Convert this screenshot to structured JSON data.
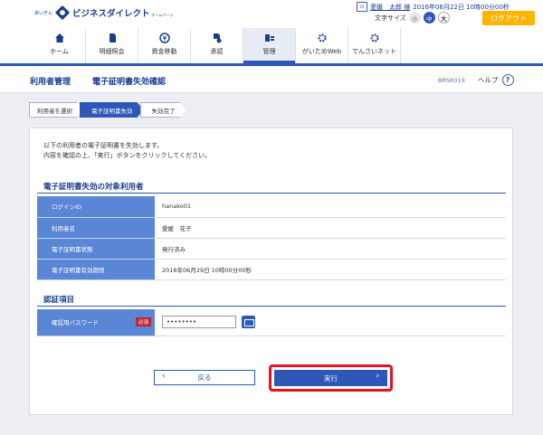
{
  "header": {
    "logo_small": "あいぎん",
    "logo_main": "ビジネスダイレクト",
    "logo_sub": "ホームページ",
    "user_icon": "ﾏｽ",
    "user_name": "愛媛　太郎 様",
    "login_datetime": "2016年06月22日 10時00分00秒",
    "font_size_label": "文字サイズ",
    "font_small": "小",
    "font_mid": "中",
    "font_large": "大",
    "logout_label": "ログアウト",
    "nav": [
      {
        "label": "ホーム",
        "icon": "home-icon"
      },
      {
        "label": "明細照会",
        "icon": "document-icon"
      },
      {
        "label": "資金移動",
        "icon": "yen-icon"
      },
      {
        "label": "承認",
        "icon": "approval-icon"
      },
      {
        "label": "管理",
        "icon": "admin-icon",
        "active": true
      },
      {
        "label": "がいためWeb",
        "icon": "gear-icon"
      },
      {
        "label": "でんさいネット",
        "icon": "gear-icon"
      }
    ]
  },
  "title_bar": {
    "breadcrumb": "利用者管理",
    "page_title": "電子証明書失効確認",
    "screen_id": "BRSK019",
    "help_label": "ヘルプ",
    "help_icon": "?"
  },
  "steps": [
    {
      "label": "利用者を選択"
    },
    {
      "label": "電子証明書失効",
      "current": true
    },
    {
      "label": "失効完了"
    }
  ],
  "message": {
    "line1": "以下の利用者の電子証明書を失効します。",
    "line2": "内容を確認の上、「実行」ボタンをクリックしてください。"
  },
  "target_section": {
    "title": "電子証明書失効の対象利用者",
    "rows": [
      {
        "label": "ログインID",
        "value": "hanako01"
      },
      {
        "label": "利用者名",
        "value": "愛媛　花子"
      },
      {
        "label": "電子証明書状態",
        "value": "発行済み"
      },
      {
        "label": "電子証明書有効期限",
        "value": "2016年06月29日 10時00分00秒"
      }
    ]
  },
  "auth_section": {
    "title": "認証項目",
    "password_label": "確認用パスワード",
    "required_label": "必須",
    "password_value": "••••••••"
  },
  "buttons": {
    "back_label": "戻る",
    "exec_label": "実行"
  }
}
